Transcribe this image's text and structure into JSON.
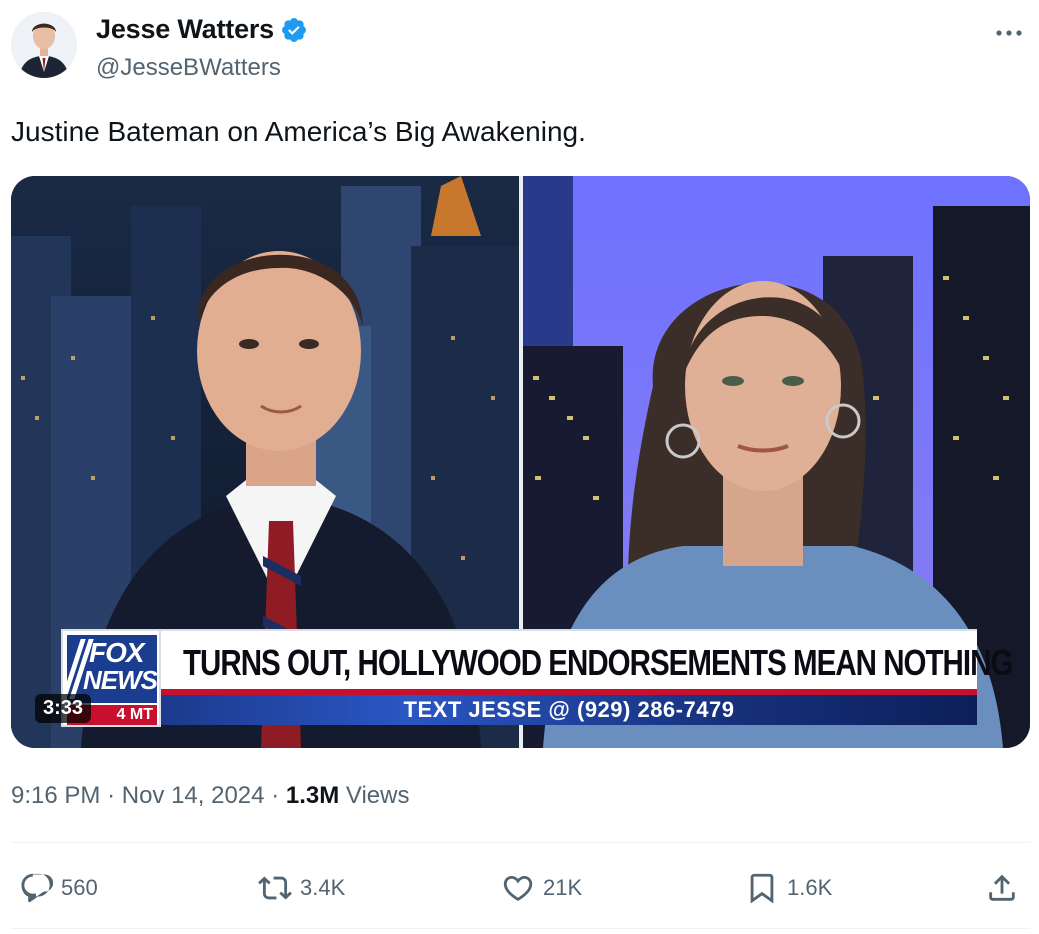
{
  "author": {
    "name": "Jesse Watters",
    "handle": "@JesseBWatters",
    "verified": true,
    "verified_color": "#1d9bf0"
  },
  "tweet": {
    "text": "Justine Bateman on America’s Big Awakening."
  },
  "media": {
    "duration": "3:33",
    "chyron_headline": "TURNS OUT, HOLLYWOOD ENDORSEMENTS MEAN NOTHING",
    "chyron_subline": "TEXT JESSE @ (929) 286-7479",
    "logo_top": "FOX",
    "logo_bottom": "NEWS",
    "logo_time_zone": "4 MT"
  },
  "meta": {
    "time": "9:16 PM",
    "date": "Nov 14, 2024",
    "views_count": "1.3M",
    "views_label": "Views"
  },
  "actions": {
    "replies": "560",
    "reposts": "3.4K",
    "likes": "21K",
    "bookmarks": "1.6K"
  },
  "icons": {
    "more": "more-horizontal-icon",
    "reply": "reply-icon",
    "repost": "repost-icon",
    "like": "heart-icon",
    "bookmark": "bookmark-icon",
    "share": "share-icon"
  }
}
